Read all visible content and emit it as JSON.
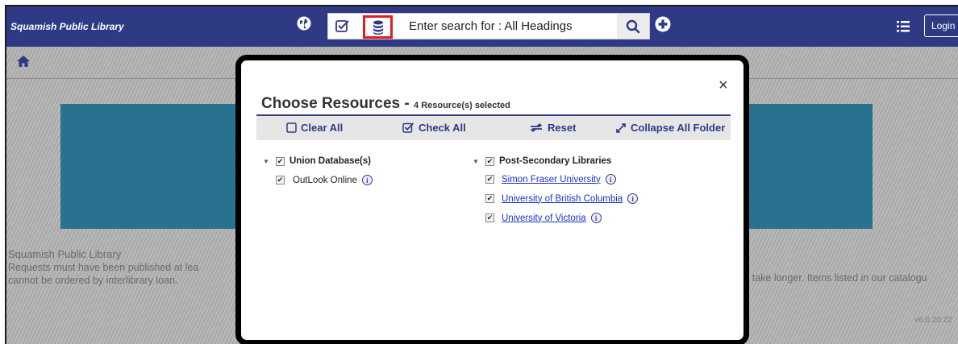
{
  "header": {
    "brand": "Squamish Public Library",
    "search_placeholder": "Enter search for : All Headings",
    "login_label": "Login"
  },
  "page": {
    "info_title": "Squamish Public Library",
    "info_line1": "Requests must have been published at lea",
    "info_line2": "cannot be ordered by interlibrary loan.",
    "info_right": "y take longer. Items listed in our catalogu",
    "version": "v6.0.20.22"
  },
  "modal": {
    "title": "Choose Resources",
    "separator": " - ",
    "subtitle": "4 Resource(s) selected",
    "close_label": "×",
    "toolbar": {
      "clear_all": "Clear All",
      "check_all": "Check All",
      "reset": "Reset",
      "collapse_all": "Collapse All Folder"
    },
    "groups": [
      {
        "label": "Union Database(s)",
        "checked": true,
        "items": [
          {
            "label": "OutLook Online",
            "checked": true,
            "link": false
          }
        ]
      },
      {
        "label": "Post-Secondary Libraries",
        "checked": true,
        "items": [
          {
            "label": "Simon Fraser University",
            "checked": true,
            "link": true
          },
          {
            "label": "University of British Columbia",
            "checked": true,
            "link": true
          },
          {
            "label": "University of Victoria",
            "checked": true,
            "link": true
          }
        ]
      }
    ]
  },
  "colors": {
    "header_bg": "#2f3a85",
    "highlight_border": "#e31b23",
    "link": "#1a31c6",
    "banner": "#1d6e8c"
  },
  "icons": {
    "globe": "globe-icon",
    "check": "checkbox-icon",
    "database": "database-icon",
    "search": "search-icon",
    "plus": "plus-circle-icon",
    "list": "list-icon",
    "home": "home-icon",
    "info": "info-icon"
  }
}
